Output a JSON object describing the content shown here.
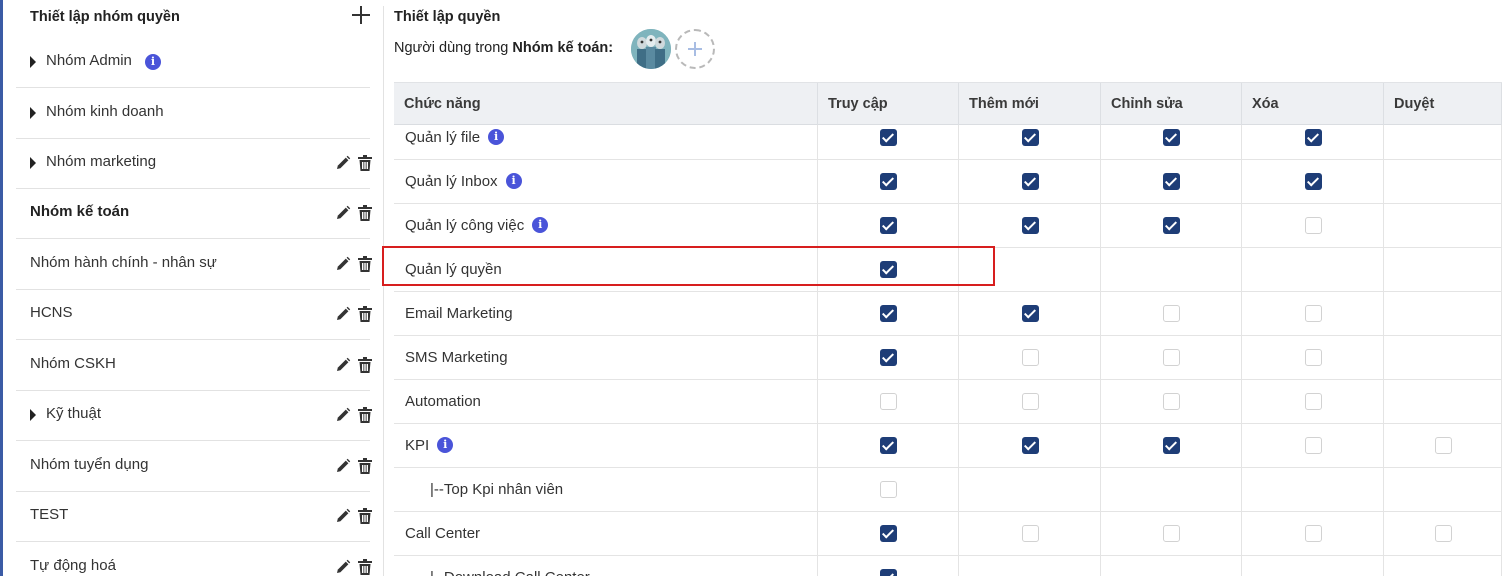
{
  "sidebar": {
    "title": "Thiết lập nhóm quyền",
    "items": [
      {
        "label": "Nhóm Admin",
        "caret": true,
        "info": true,
        "actions": false,
        "bold": false
      },
      {
        "label": "Nhóm kinh doanh",
        "caret": true,
        "info": false,
        "actions": false,
        "bold": false
      },
      {
        "label": "Nhóm marketing",
        "caret": true,
        "info": false,
        "actions": true,
        "bold": false
      },
      {
        "label": "Nhóm kế toán",
        "caret": false,
        "info": false,
        "actions": true,
        "bold": true
      },
      {
        "label": "Nhóm hành chính - nhân sự",
        "caret": false,
        "info": false,
        "actions": true,
        "bold": false
      },
      {
        "label": "HCNS",
        "caret": false,
        "info": false,
        "actions": true,
        "bold": false
      },
      {
        "label": "Nhóm CSKH",
        "caret": false,
        "info": false,
        "actions": true,
        "bold": false
      },
      {
        "label": "Kỹ thuật",
        "caret": true,
        "info": false,
        "actions": true,
        "bold": false
      },
      {
        "label": "Nhóm tuyển dụng",
        "caret": false,
        "info": false,
        "actions": true,
        "bold": false
      },
      {
        "label": "TEST",
        "caret": false,
        "info": false,
        "actions": true,
        "bold": false
      },
      {
        "label": "Tự động hoá",
        "caret": false,
        "info": false,
        "actions": true,
        "bold": false
      }
    ]
  },
  "main": {
    "title": "Thiết lập quyền",
    "users_prefix": "Người dùng trong ",
    "users_group": "Nhóm kế toán:",
    "columns": [
      "Chức năng",
      "Truy cập",
      "Thêm mới",
      "Chỉnh sửa",
      "Xóa",
      "Duyệt"
    ],
    "rows": [
      {
        "name": "Quản lý file",
        "info": true,
        "sub": false,
        "perms": [
          true,
          true,
          true,
          true,
          null
        ]
      },
      {
        "name": "Quản lý Inbox",
        "info": true,
        "sub": false,
        "perms": [
          true,
          true,
          true,
          true,
          null
        ]
      },
      {
        "name": "Quản lý công việc",
        "info": true,
        "sub": false,
        "perms": [
          true,
          true,
          true,
          false,
          null
        ]
      },
      {
        "name": "Quản lý quyền",
        "info": false,
        "sub": false,
        "perms": [
          true,
          null,
          null,
          null,
          null
        ]
      },
      {
        "name": "Email Marketing",
        "info": false,
        "sub": false,
        "perms": [
          true,
          true,
          false,
          false,
          null
        ]
      },
      {
        "name": "SMS Marketing",
        "info": false,
        "sub": false,
        "perms": [
          true,
          false,
          false,
          false,
          null
        ]
      },
      {
        "name": "Automation",
        "info": false,
        "sub": false,
        "perms": [
          false,
          false,
          false,
          false,
          null
        ]
      },
      {
        "name": "KPI",
        "info": true,
        "sub": false,
        "perms": [
          true,
          true,
          true,
          false,
          false
        ]
      },
      {
        "name": "|--Top Kpi nhân viên",
        "info": false,
        "sub": true,
        "perms": [
          false,
          null,
          null,
          null,
          null
        ]
      },
      {
        "name": "Call Center",
        "info": false,
        "sub": false,
        "perms": [
          true,
          false,
          false,
          false,
          false
        ]
      },
      {
        "name": "|--Download Call Center",
        "info": false,
        "sub": true,
        "perms": [
          true,
          null,
          null,
          null,
          null
        ]
      }
    ]
  },
  "colors": {
    "checked": "#1e3d77",
    "info": "#4a54d9",
    "highlight": "#d71e1e",
    "header_bg": "#eef0f3"
  }
}
